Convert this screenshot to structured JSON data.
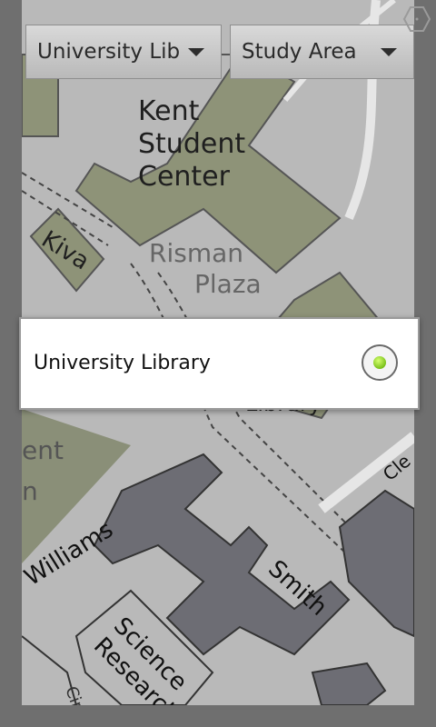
{
  "map": {
    "labels": {
      "kent": "Kent",
      "student": "Student",
      "center": "Center",
      "kiva": "Kiva",
      "risman": "Risman",
      "plaza": "Plaza",
      "library_partial": "Library",
      "ent_partial": "ent",
      "n_partial": "n",
      "williams": "Williams",
      "smith": "Smith",
      "science": "Science",
      "research": "Research",
      "cir_partial": "Cir.",
      "clev_partial": "Cle"
    }
  },
  "filters": {
    "building": {
      "selected": "University Library"
    },
    "category": {
      "selected": "Study Area"
    }
  },
  "popup": {
    "label": "University Library",
    "selected": true
  },
  "icons": {
    "dropdown": "chevron-down-icon",
    "radio": "radio-selected-icon",
    "corner": "hexagon-icon"
  },
  "colors": {
    "building_green": "#8e9378",
    "lawn": "#8a8f78",
    "building_gray": "#6d6d74",
    "radio_green": "#7ac11a"
  }
}
